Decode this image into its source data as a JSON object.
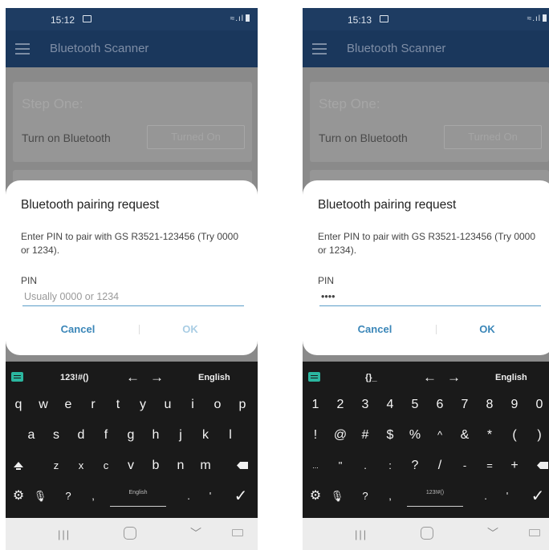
{
  "colors": {
    "status_bar": "#1e3c62",
    "app_bar": "#1a375c",
    "dim_overlay": "#8a8a8a",
    "accent": "#3a86b8",
    "keyboard_bg": "#1a1a1a"
  },
  "screens": [
    {
      "status": {
        "time": "15:12",
        "right": "≈.ıl"
      },
      "app": {
        "title": "Bluetooth Scanner",
        "step_title": "Step One:",
        "turn_on_label": "Turn on Bluetooth",
        "turned_on_button": "Turned On"
      },
      "dialog": {
        "title": "Bluetooth pairing request",
        "message": "Enter PIN to pair with GS R3521-123456 (Try 0000 or 1234).",
        "pin_label": "PIN",
        "pin_value": "",
        "pin_placeholder": "Usually 0000 or 1234",
        "cancel": "Cancel",
        "ok": "OK"
      },
      "keyboard": {
        "toolbar_mode": "123!#()",
        "arrow_left": "←",
        "arrow_right": "→",
        "language": "English",
        "row1": [
          "q",
          "w",
          "e",
          "r",
          "t",
          "y",
          "u",
          "i",
          "o",
          "p"
        ],
        "row2": [
          "a",
          "s",
          "d",
          "f",
          "g",
          "h",
          "j",
          "k",
          "l"
        ],
        "row3": [
          "z",
          "x",
          "c",
          "v",
          "b",
          "n",
          "m"
        ],
        "row4": {
          "gear": "⚙",
          "mic": "🎙",
          "question": "?",
          "comma": ",",
          "space_label": "English",
          "period": ".",
          "apostrophe": "'",
          "enter": "✓"
        }
      }
    },
    {
      "status": {
        "time": "15:13",
        "right": "≈.ıl"
      },
      "app": {
        "title": "Bluetooth Scanner",
        "step_title": "Step One:",
        "turn_on_label": "Turn on Bluetooth",
        "turned_on_button": "Turned On"
      },
      "dialog": {
        "title": "Bluetooth pairing request",
        "message": "Enter PIN to pair with GS R3521-123456 (Try 0000 or 1234).",
        "pin_label": "PIN",
        "pin_value": "••••",
        "pin_placeholder": "",
        "cancel": "Cancel",
        "ok": "OK"
      },
      "keyboard": {
        "toolbar_mode": "{}_",
        "arrow_left": "←",
        "arrow_right": "→",
        "language": "English",
        "row1": [
          "1",
          "2",
          "3",
          "4",
          "5",
          "6",
          "7",
          "8",
          "9",
          "0"
        ],
        "row2": [
          "!",
          "@",
          "#",
          "$",
          "%",
          "^",
          "&",
          "*",
          "(",
          ")"
        ],
        "row3": [
          "...",
          "\"",
          ".",
          ":",
          "?",
          "/",
          "-",
          "=",
          "+"
        ],
        "row4": {
          "gear": "⚙",
          "mic": "🎙",
          "question": "?",
          "comma": ",",
          "space_label": "123!#()",
          "period": ".",
          "apostrophe": "'",
          "enter": "✓"
        }
      }
    }
  ],
  "navbar": {
    "recents": "|||",
    "back": "﹀"
  }
}
